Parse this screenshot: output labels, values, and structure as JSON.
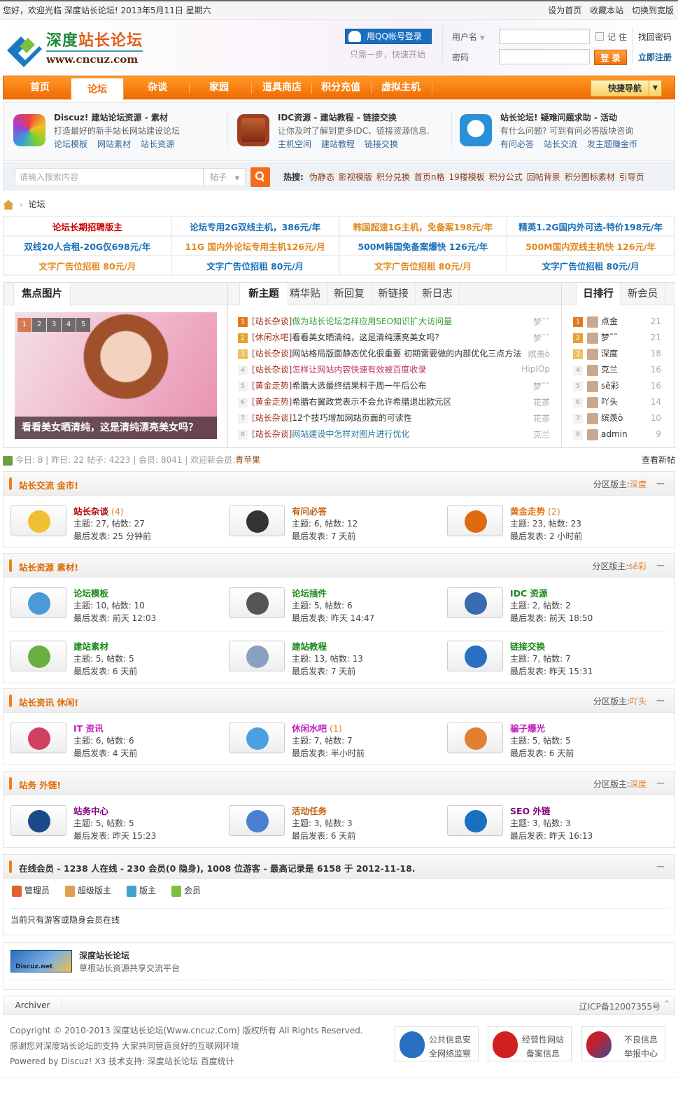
{
  "topbar": {
    "welcome": "您好，欢迎光临 深度站长论坛! 2013年5月11日 星期六",
    "links": [
      "设为首页",
      "收藏本站",
      "切换到宽版"
    ]
  },
  "header": {
    "logo_title_a": "深度",
    "logo_title_b": "站长论坛",
    "logo_url": "www.cncuz.com",
    "qq_login": "用QQ帐号登录",
    "qq_sub": "只需一步，快速开始",
    "username_label": "用户名",
    "password_label": "密码",
    "remember": "记 住",
    "login_btn": "登 录",
    "forgot": "找回密码",
    "register": "立即注册"
  },
  "nav": {
    "items": [
      "首页",
      "论坛",
      "杂谈",
      "家园",
      "道具商店",
      "积分充值",
      "虚拟主机"
    ],
    "active": 1,
    "quick": "快捷导航"
  },
  "info": [
    {
      "title": "Discuz! 建站论坛资源 - 素材",
      "desc": "打造最好的新手站长网站建设论坛",
      "links": [
        "论坛模板",
        "网站素材",
        "站长资源"
      ]
    },
    {
      "title": "IDC资源 - 建站教程 - 链接交换",
      "desc": "让你及时了解到更多IDC、链接资源信息.",
      "links": [
        "主机空间",
        "建站教程",
        "链接交换"
      ]
    },
    {
      "title": "站长论坛! 疑难问题求助 - 活动",
      "desc": "有什么问题? 可到有问必答版块咨询",
      "links": [
        "有问必答",
        "站长交流",
        "发主题赚金币"
      ]
    }
  ],
  "search": {
    "placeholder": "请输入搜索内容",
    "type": "帖子",
    "hot_label": "热搜:",
    "hot": [
      "伪静态",
      "影视模版",
      "积分兑换",
      "首页n格",
      "19楼模板",
      "积分公式",
      "回帖背景",
      "积分图标素材",
      "引导页"
    ]
  },
  "breadcrumb": {
    "current": "论坛"
  },
  "ads": [
    [
      {
        "t": "论坛长期招聘版主",
        "c": "#cc0000"
      },
      {
        "t": "论坛专用2G双线主机，386元/年",
        "c": "#1a70b8"
      },
      {
        "t": "韩国超速1G主机，免备案198元/年",
        "c": "#e08a20"
      },
      {
        "t": "精英1.2G国内外可选-特价198元/年",
        "c": "#1a70b8"
      }
    ],
    [
      {
        "t": "双线20人合租-20G仅698元/年",
        "c": "#1a70b8"
      },
      {
        "t": "11G 国内外论坛专用主机126元/月",
        "c": "#e08a20"
      },
      {
        "t": "500M韩国免备案爆快  126元/年",
        "c": "#1a70b8"
      },
      {
        "t": "500M国内双线主机快  126元/年",
        "c": "#e08a20"
      }
    ],
    [
      {
        "t": "文字广告位招租  80元/月",
        "c": "#e08a20"
      },
      {
        "t": "文字广告位招租  80元/月",
        "c": "#1a70b8"
      },
      {
        "t": "文字广告位招租  80元/月",
        "c": "#e08a20"
      },
      {
        "t": "文字广告位招租  80元/月",
        "c": "#1a70b8"
      }
    ]
  ],
  "portal": {
    "focus_tab": "焦点图片",
    "slide_nums": [
      "1",
      "2",
      "3",
      "4",
      "5"
    ],
    "slide_caption": "看看美女晒清纯，这是清纯漂亮美女吗？",
    "tabs": [
      "新主题",
      "精华贴",
      "新回复",
      "新链接",
      "新日志"
    ],
    "threads": [
      {
        "cat": "[站长杂谈]",
        "title": "做为站长论坛怎样应用SEO知识扩大访问量",
        "author": "梦˜˜",
        "c": "#3a9a3a"
      },
      {
        "cat": "[休闲水吧]",
        "title": "看看美女晒清纯，这是清纯漂亮美女吗?",
        "author": "梦˜˜",
        "c": "#333"
      },
      {
        "cat": "[站长杂谈]",
        "title": "网站格局版面静态优化很重要 初期需要做的内部优化三点方法",
        "author": "缤羡ò",
        "c": "#333"
      },
      {
        "cat": "[站长杂谈]",
        "title": "怎样让网站内容快速有效被百度收录",
        "author": "HipIOp",
        "c": "#c03060"
      },
      {
        "cat": "[黄金走势]",
        "title": "希腊大选最终结果料于周一午后公布",
        "author": "梦˜˜",
        "c": "#333"
      },
      {
        "cat": "[黄金走势]",
        "title": "希腊右翼政党表示不会允许希腊退出欧元区",
        "author": "花茶",
        "c": "#333"
      },
      {
        "cat": "[站长杂谈]",
        "title": "12个技巧增加网站页面的可读性",
        "author": "花茶",
        "c": "#333"
      },
      {
        "cat": "[站长杂谈]",
        "title": "网站建设中怎样对图片进行优化",
        "author": "克兰",
        "c": "#2a7a9a"
      }
    ],
    "rank_tabs": [
      "日排行",
      "新会员"
    ],
    "ranks": [
      {
        "n": "点金",
        "s": "21"
      },
      {
        "n": "梦˜˜",
        "s": "21"
      },
      {
        "n": "深度",
        "s": "18"
      },
      {
        "n": "克兰",
        "s": "16"
      },
      {
        "n": "sě彩",
        "s": "16"
      },
      {
        "n": "吖头",
        "s": "14"
      },
      {
        "n": "缤羡ò",
        "s": "10"
      },
      {
        "n": "admin",
        "s": "9"
      }
    ]
  },
  "stats": {
    "today": "今日: 8",
    "yesterday": "昨日: 22",
    "posts": "帖子: 4223",
    "members": "会员: 8041",
    "welcome": "欢迎新会员:",
    "newest": "青苹果",
    "view_new": "查看新帖"
  },
  "sections": [
    {
      "title": "站长交流  金市!",
      "mod_label": "分区版主:",
      "mod": "深度",
      "forums": [
        {
          "name": "站长杂谈",
          "new": "(4)",
          "stat": "主题: 27, 帖数: 27",
          "last": "最后发表: 25 分钟前",
          "c": "#b00000",
          "ic": "#f0c030"
        },
        {
          "name": "有问必答",
          "new": "",
          "stat": "主题: 6, 帖数: 12",
          "last": "最后发表: 7 天前",
          "c": "#c06010",
          "ic": "#333"
        },
        {
          "name": "黄金走势",
          "new": "(2)",
          "stat": "主题: 23, 帖数: 23",
          "last": "最后发表: 2 小时前",
          "c": "#e07010",
          "ic": "#e06a10"
        }
      ]
    },
    {
      "title": "站长资源  素材!",
      "mod_label": "分区版主:",
      "mod": "sě彩",
      "forums": [
        {
          "name": "论坛模板",
          "new": "",
          "stat": "主题: 10, 帖数: 10",
          "last": "最后发表: 前天 12:03",
          "c": "#1a8a1a",
          "ic": "#4a9ad8"
        },
        {
          "name": "论坛插件",
          "new": "",
          "stat": "主题: 5, 帖数: 6",
          "last": "最后发表: 昨天 14:47",
          "c": "#1a8a1a",
          "ic": "#555"
        },
        {
          "name": "IDC 资源",
          "new": "",
          "stat": "主题: 2, 帖数: 2",
          "last": "最后发表: 前天 18:50",
          "c": "#1a8a1a",
          "ic": "#3a6ab0"
        },
        {
          "name": "建站素材",
          "new": "",
          "stat": "主题: 5, 帖数: 5",
          "last": "最后发表: 6 天前",
          "c": "#1a8a1a",
          "ic": "#6ab040"
        },
        {
          "name": "建站教程",
          "new": "",
          "stat": "主题: 13, 帖数: 13",
          "last": "最后发表: 7 天前",
          "c": "#1a8a1a",
          "ic": "#8aa0c0"
        },
        {
          "name": "链接交换",
          "new": "",
          "stat": "主题: 7, 帖数: 7",
          "last": "最后发表: 昨天 15:31",
          "c": "#1a8a1a",
          "ic": "#2a70c0"
        }
      ]
    },
    {
      "title": "站长资讯  休闲!",
      "mod_label": "分区版主:",
      "mod": "吖头",
      "forums": [
        {
          "name": "IT 资讯",
          "new": "",
          "stat": "主题: 6, 帖数: 6",
          "last": "最后发表: 4 天前",
          "c": "#c020c0",
          "ic": "#d04060"
        },
        {
          "name": "休闲水吧",
          "new": "(1)",
          "stat": "主题: 7, 帖数: 7",
          "last": "最后发表: 半小时前",
          "c": "#c020c0",
          "ic": "#4aa0e0"
        },
        {
          "name": "骗子爆光",
          "new": "",
          "stat": "主题: 5, 帖数: 5",
          "last": "最后发表: 6 天前",
          "c": "#c020c0",
          "ic": "#e08030"
        }
      ]
    },
    {
      "title": "站务  外链!",
      "mod_label": "分区版主:",
      "mod": "深度",
      "forums": [
        {
          "name": "站务中心",
          "new": "",
          "stat": "主题: 5, 帖数: 5",
          "last": "最后发表: 昨天 15:23",
          "c": "#800080",
          "ic": "#1a4a8a"
        },
        {
          "name": "活动任务",
          "new": "",
          "stat": "主题: 3, 帖数: 3",
          "last": "最后发表: 6 天前",
          "c": "#c06010",
          "ic": "#4a80d0"
        },
        {
          "name": "SEO 外链",
          "new": "",
          "stat": "主题: 3, 帖数: 3",
          "last": "最后发表: 昨天 16:13",
          "c": "#800080",
          "ic": "#1a70c0"
        }
      ]
    }
  ],
  "online": {
    "title": "在线会员  - 1238 人在线  - 230 会员(0 隐身), 1008 位游客 - 最高记录是  6158 于  2012-11-18.",
    "legend": [
      {
        "t": "管理员",
        "c": "#e06030"
      },
      {
        "t": "超级版主",
        "c": "#e0a050"
      },
      {
        "t": "版主",
        "c": "#40a0d0"
      },
      {
        "t": "会员",
        "c": "#80c040"
      }
    ],
    "note": "当前只有游客或隐身会员在线"
  },
  "links": {
    "logo_text": "Discuz.net",
    "name": "深度站长论坛",
    "desc": "草根站长资源共享交流平台"
  },
  "footer": {
    "archiver": "Archiver",
    "icp": "辽ICP备12007355号",
    "copyright": "Copyright © 2010-2013 深度站长论坛(Www.cncuz.Com) 版权所有  All Rights Reserved.",
    "thanks": "感谢您对深度站长论坛的支持  大家共同营造良好的互联网环境",
    "powered": "Powered by Discuz! X3  技术支持: 深度站长论坛 百度统计",
    "badges": [
      {
        "l1": "公共信息安",
        "l2": "全网络监察",
        "c": "#2a70c0"
      },
      {
        "l1": "经营性网站",
        "l2": "备案信息",
        "c": "#d02020"
      },
      {
        "l1": "不良信息",
        "l2": "举报中心",
        "c": "#c02030"
      }
    ]
  }
}
